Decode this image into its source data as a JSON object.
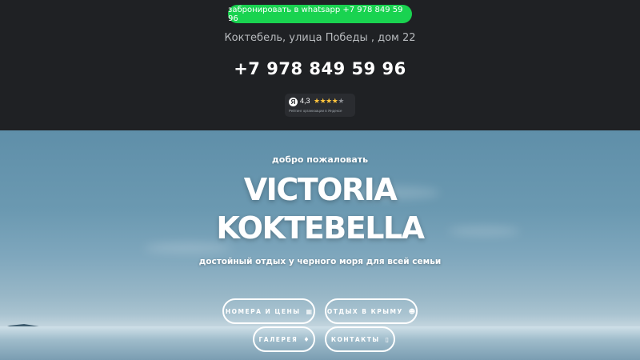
{
  "header": {
    "whatsapp_button": "забронировать в whatsapp +7 978 849 59 96",
    "address": "Коктебель, улица Победы , дом 22",
    "phone": "+7 978 849 59 96",
    "rating": {
      "logo": "Я",
      "value": "4,3",
      "stars": 4.3,
      "caption": "Рейтинг организации в Яндексе"
    }
  },
  "hero": {
    "welcome": "добро пожаловать",
    "title_line1": "VICTORIA",
    "title_line2": "KOKTEBELLA",
    "subtitle": "достойный отдых у черного моря для всей семьи"
  },
  "nav": {
    "rooms": {
      "label": "номера и цены",
      "icon": "calendar-icon"
    },
    "rest": {
      "label": "отдых в крыму",
      "icon": "person-icon"
    },
    "gallery": {
      "label": "галерея",
      "icon": "drop-icon"
    },
    "contacts": {
      "label": "контакты",
      "icon": "phone-icon"
    }
  },
  "colors": {
    "header_bg": "#1f2124",
    "whatsapp_green": "#19d350",
    "star_gold": "#ffc43d"
  }
}
